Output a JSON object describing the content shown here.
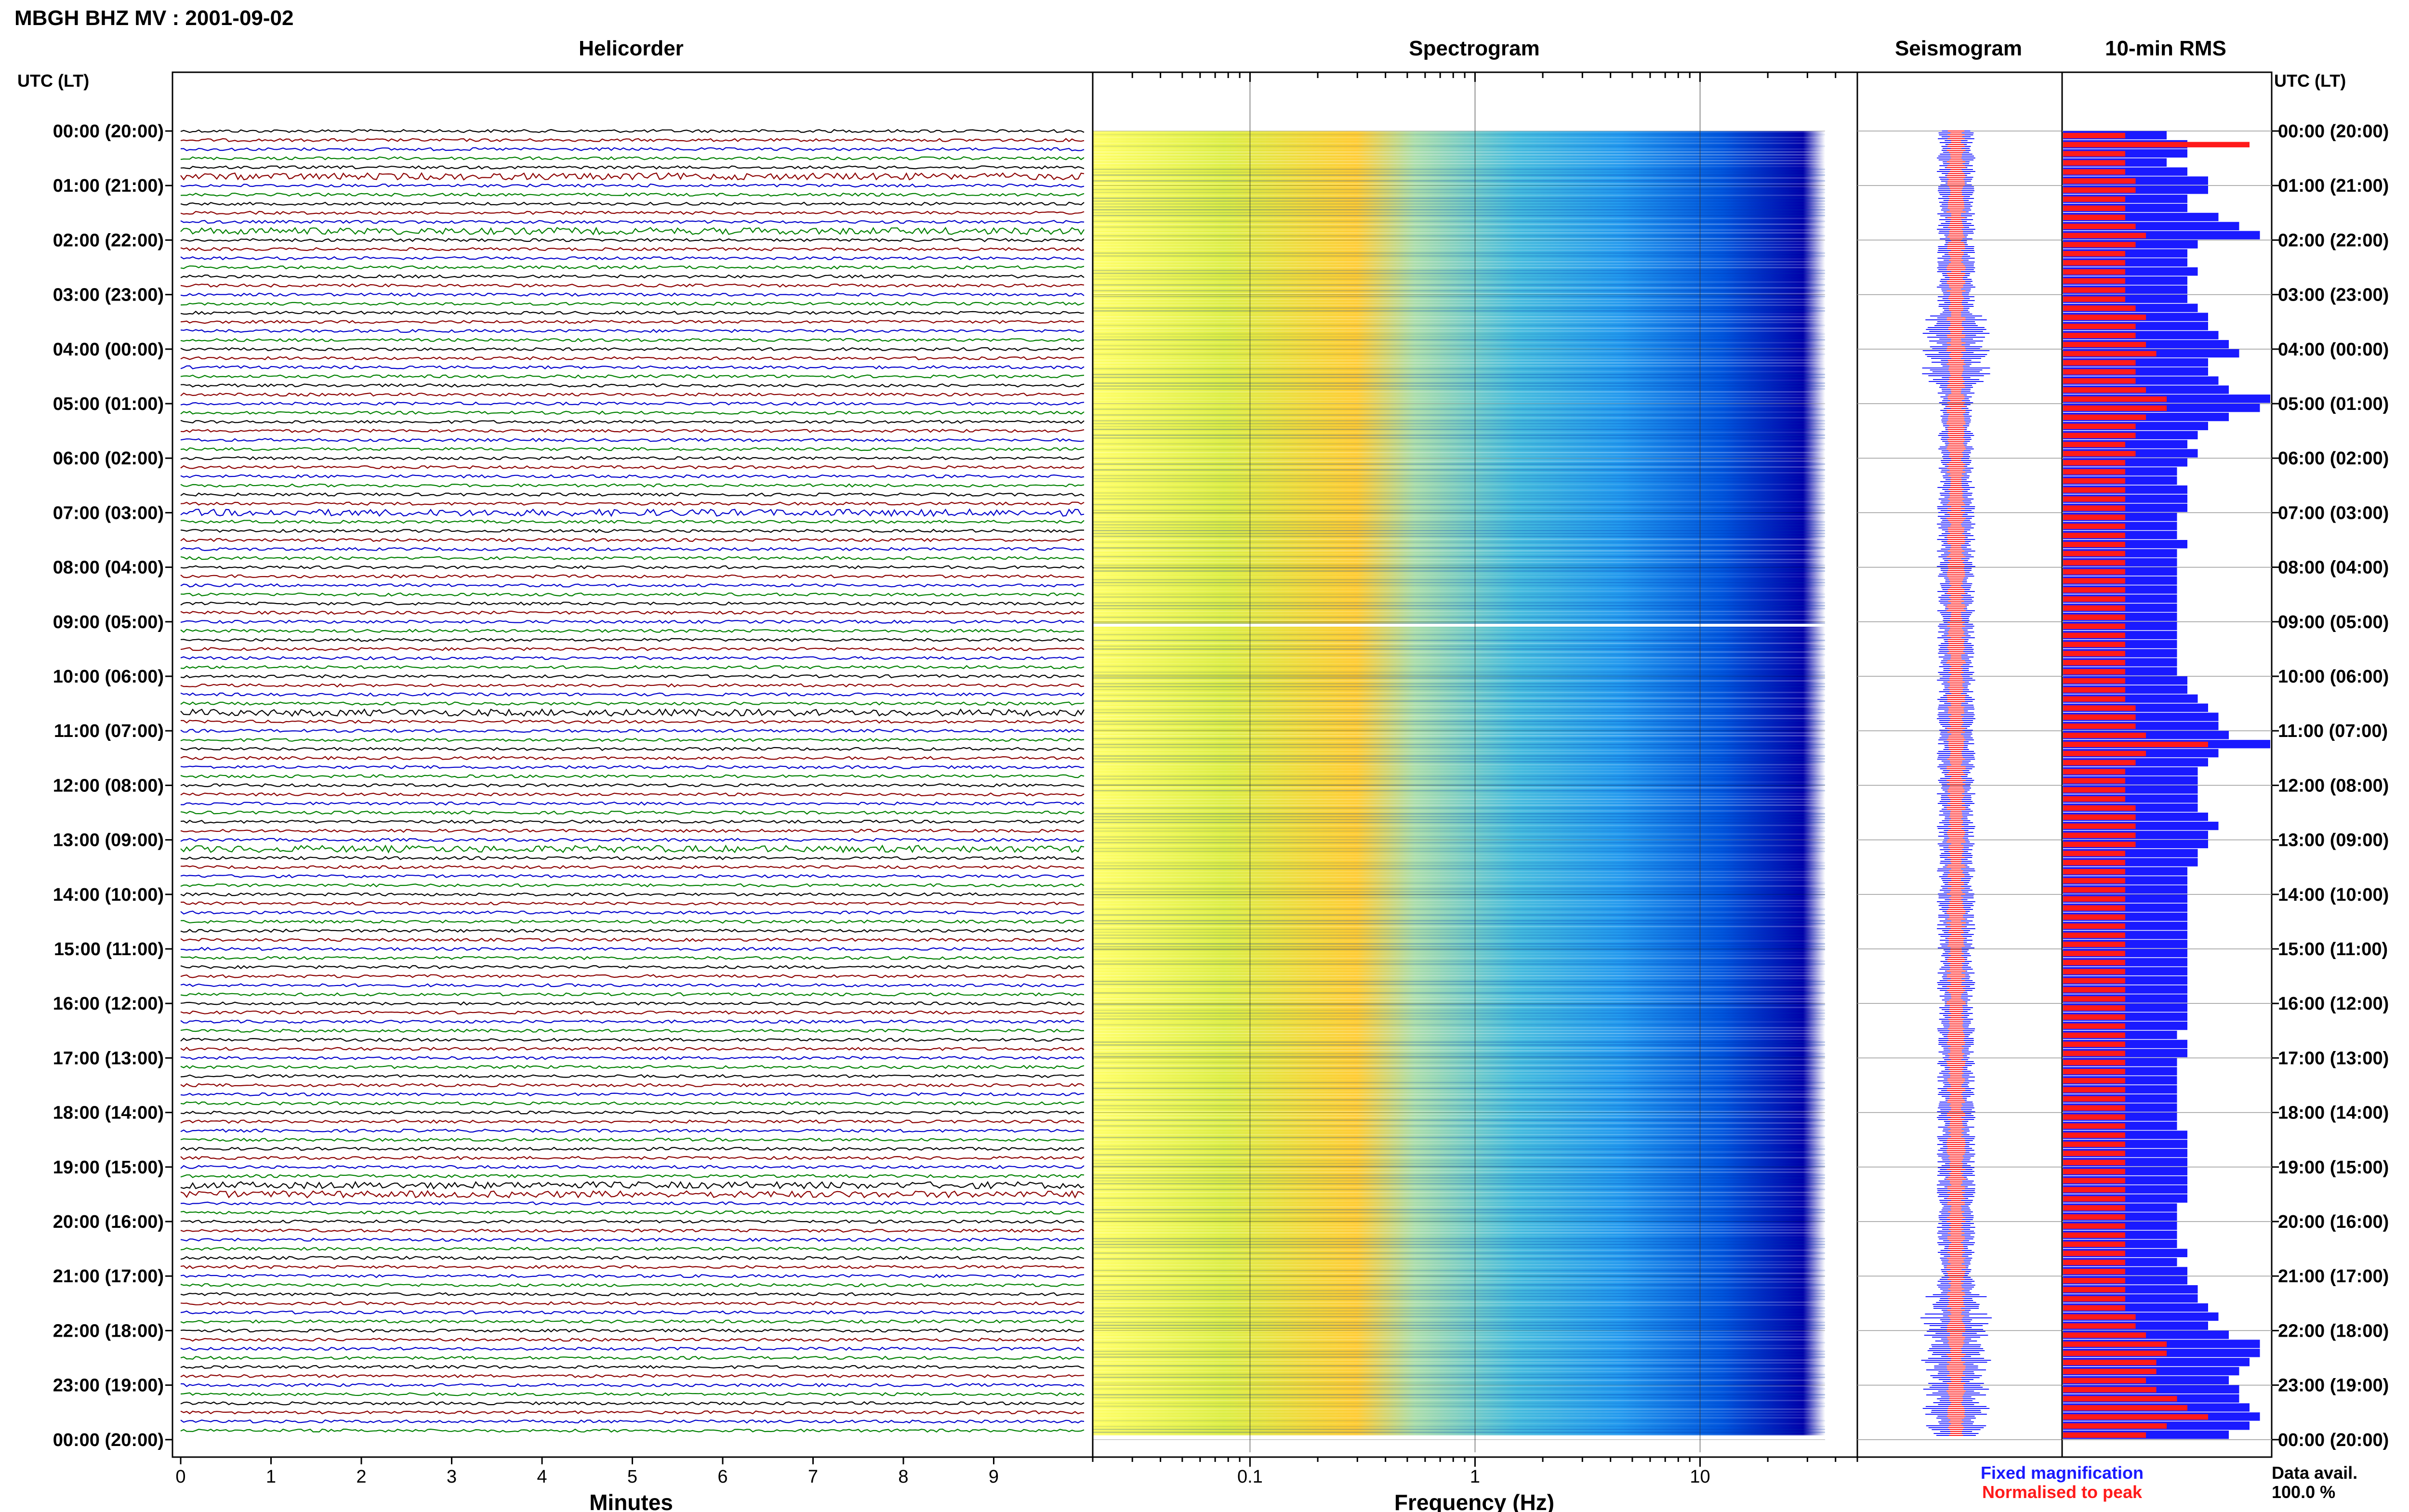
{
  "header": {
    "title": "MBGH BHZ MV : 2001-09-02",
    "tz_label_left": "UTC (LT)",
    "tz_label_right": "UTC (LT)"
  },
  "panels": {
    "helicorder": "Helicorder",
    "spectrogram": "Spectrogram",
    "seismogram": "Seismogram",
    "rms": "10-min RMS"
  },
  "axes": {
    "helicorder_xlabel": "Minutes",
    "spectrogram_xlabel": "Frequency (Hz)"
  },
  "legend": {
    "fixed": "Fixed magnification",
    "normalised": "Normalised to peak",
    "fixed_color": "#1a1aff",
    "normalised_color": "#ff1a1a"
  },
  "availability": {
    "label": "Data avail.",
    "value": "100.0 %"
  },
  "chart_data": [
    {
      "type": "line",
      "panel": "helicorder",
      "title": "Helicorder",
      "xlabel": "Minutes",
      "x_ticks": [
        "0",
        "1",
        "2",
        "3",
        "4",
        "5",
        "6",
        "7",
        "8",
        "9"
      ],
      "xlim": [
        0,
        10
      ],
      "row_labels": [
        "00:00 (20:00)",
        "01:00 (21:00)",
        "02:00 (22:00)",
        "03:00 (23:00)",
        "04:00 (00:00)",
        "05:00 (01:00)",
        "06:00 (02:00)",
        "07:00 (03:00)",
        "08:00 (04:00)",
        "09:00 (05:00)",
        "10:00 (06:00)",
        "11:00 (07:00)",
        "12:00 (08:00)",
        "13:00 (09:00)",
        "14:00 (10:00)",
        "15:00 (11:00)",
        "16:00 (12:00)",
        "17:00 (13:00)",
        "18:00 (14:00)",
        "19:00 (15:00)",
        "20:00 (16:00)",
        "21:00 (17:00)",
        "22:00 (18:00)",
        "23:00 (19:00)",
        "00:00 (20:00)"
      ],
      "trace_colors": [
        "#000000",
        "#8b0000",
        "#0000cc",
        "#008000"
      ],
      "traces_per_hour": 6
    },
    {
      "type": "heatmap",
      "panel": "spectrogram",
      "title": "Spectrogram",
      "xlabel": "Frequency (Hz)",
      "x_scale": "log",
      "x_ticks": [
        "0.1",
        "1",
        "10"
      ],
      "xlim": [
        0.02,
        50
      ],
      "colormap": [
        "#ffff66",
        "#66ddcc",
        "#1a88ff",
        "#0000cc"
      ]
    },
    {
      "type": "line",
      "panel": "seismogram",
      "title": "Seismogram",
      "series": [
        {
          "name": "Fixed magnification",
          "color": "#1a1aff"
        },
        {
          "name": "Normalised to peak",
          "color": "#ff1a1a"
        }
      ]
    },
    {
      "type": "bar",
      "panel": "rms",
      "title": "10-min RMS",
      "orientation": "horizontal",
      "bars_per_hour": 6,
      "series": [
        {
          "name": "Fixed magnification",
          "color": "#1a1aff",
          "values": [
            0.5,
            0.6,
            0.6,
            0.5,
            0.6,
            0.7,
            0.7,
            0.6,
            0.6,
            0.75,
            0.85,
            0.95,
            0.65,
            0.6,
            0.6,
            0.65,
            0.6,
            0.6,
            0.6,
            0.65,
            0.7,
            0.7,
            0.75,
            0.8,
            0.85,
            0.7,
            0.7,
            0.75,
            0.8,
            1.0,
            0.95,
            0.8,
            0.7,
            0.65,
            0.6,
            0.65,
            0.6,
            0.55,
            0.55,
            0.6,
            0.6,
            0.6,
            0.55,
            0.55,
            0.55,
            0.6,
            0.55,
            0.55,
            0.55,
            0.55,
            0.55,
            0.55,
            0.55,
            0.55,
            0.55,
            0.55,
            0.55,
            0.55,
            0.55,
            0.55,
            0.6,
            0.6,
            0.65,
            0.7,
            0.75,
            0.75,
            0.8,
            1.0,
            0.75,
            0.7,
            0.65,
            0.65,
            0.65,
            0.65,
            0.65,
            0.7,
            0.75,
            0.7,
            0.7,
            0.65,
            0.65,
            0.6,
            0.6,
            0.6,
            0.6,
            0.6,
            0.6,
            0.6,
            0.6,
            0.6,
            0.6,
            0.6,
            0.6,
            0.6,
            0.6,
            0.6,
            0.6,
            0.6,
            0.6,
            0.55,
            0.6,
            0.6,
            0.55,
            0.55,
            0.55,
            0.55,
            0.55,
            0.55,
            0.55,
            0.55,
            0.6,
            0.6,
            0.6,
            0.6,
            0.6,
            0.6,
            0.6,
            0.6,
            0.55,
            0.55,
            0.55,
            0.55,
            0.55,
            0.6,
            0.55,
            0.6,
            0.6,
            0.65,
            0.65,
            0.7,
            0.75,
            0.7,
            0.8,
            0.95,
            0.95,
            0.9,
            0.85,
            0.8,
            0.85,
            0.85,
            0.9,
            0.95,
            0.9,
            0.8
          ]
        },
        {
          "name": "Normalised to peak",
          "color": "#ff1a1a",
          "values": [
            0.3,
            0.9,
            0.3,
            0.3,
            0.3,
            0.35,
            0.35,
            0.3,
            0.3,
            0.3,
            0.35,
            0.4,
            0.35,
            0.3,
            0.3,
            0.3,
            0.3,
            0.3,
            0.3,
            0.35,
            0.4,
            0.35,
            0.35,
            0.4,
            0.45,
            0.35,
            0.35,
            0.35,
            0.4,
            0.5,
            0.5,
            0.4,
            0.35,
            0.35,
            0.3,
            0.35,
            0.3,
            0.3,
            0.3,
            0.3,
            0.3,
            0.3,
            0.3,
            0.3,
            0.3,
            0.3,
            0.3,
            0.3,
            0.3,
            0.3,
            0.3,
            0.3,
            0.3,
            0.3,
            0.3,
            0.3,
            0.3,
            0.3,
            0.3,
            0.3,
            0.3,
            0.3,
            0.3,
            0.35,
            0.35,
            0.35,
            0.4,
            0.7,
            0.4,
            0.35,
            0.3,
            0.3,
            0.3,
            0.3,
            0.35,
            0.35,
            0.35,
            0.35,
            0.35,
            0.3,
            0.3,
            0.3,
            0.3,
            0.3,
            0.3,
            0.3,
            0.3,
            0.3,
            0.3,
            0.3,
            0.3,
            0.3,
            0.3,
            0.3,
            0.3,
            0.3,
            0.3,
            0.3,
            0.3,
            0.3,
            0.3,
            0.3,
            0.3,
            0.3,
            0.3,
            0.3,
            0.3,
            0.3,
            0.3,
            0.3,
            0.3,
            0.3,
            0.3,
            0.3,
            0.3,
            0.3,
            0.3,
            0.3,
            0.3,
            0.3,
            0.3,
            0.3,
            0.3,
            0.3,
            0.3,
            0.3,
            0.3,
            0.3,
            0.3,
            0.3,
            0.35,
            0.35,
            0.4,
            0.5,
            0.5,
            0.45,
            0.45,
            0.4,
            0.45,
            0.55,
            0.6,
            0.7,
            0.5,
            0.4
          ]
        }
      ]
    }
  ]
}
